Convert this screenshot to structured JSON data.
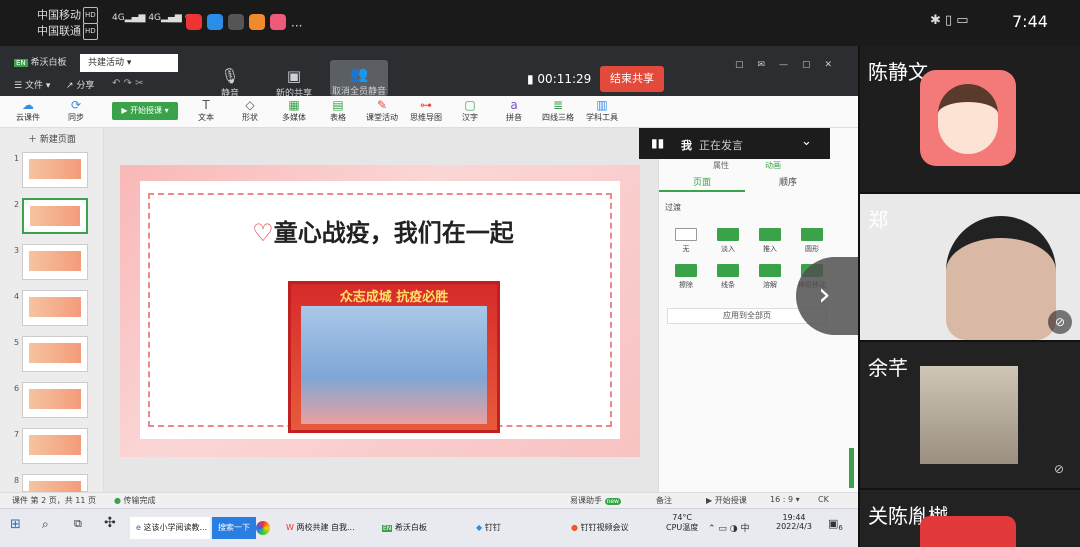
{
  "status_bar": {
    "carrier1": "中国移动",
    "carrier2": "中国联通",
    "hd": "HD",
    "net1": "4G",
    "net2": "4G",
    "time": "7:44"
  },
  "app": {
    "tabs": [
      "希沃白板",
      "共建活动"
    ],
    "menu": [
      "文件",
      "分享"
    ],
    "meeting_tools": [
      "静音",
      "新的共享",
      "取消全员静音"
    ],
    "timer": "00:11:29",
    "end_share": "结束共享",
    "left_tools": [
      "云课件",
      "同步"
    ],
    "start_class": "开始授课",
    "ribbon_tools": [
      "文本",
      "形状",
      "多媒体",
      "表格",
      "课堂活动",
      "思维导图",
      "汉字",
      "拼音",
      "四线三格",
      "学科工具"
    ],
    "new_page": "新建页面",
    "slide_numbers": [
      "1",
      "2",
      "3",
      "4",
      "5",
      "6",
      "7",
      "8"
    ],
    "slide_title": "童心战疫，我们在一起",
    "poster_text": "众志成城  抗疫必胜",
    "right_tabs": [
      "属性",
      "动画"
    ],
    "right_subtabs": [
      "页面",
      "顺序"
    ],
    "transition_label": "过渡",
    "transitions": [
      "无",
      "淡入",
      "推入",
      "圆形",
      "擦除",
      "线条",
      "溶解",
      "神奇移动"
    ],
    "apply_all": "应用到全部页",
    "speaking_name": "我",
    "speaking_text": "正在发言",
    "status_pages": "课件 第 2 页，共 11 页",
    "status_upload": "传输完成",
    "status_right": [
      "易课助手",
      "new",
      "备注",
      "开始授课",
      "16 : 9",
      "CK"
    ]
  },
  "taskbar": {
    "search": "搜索一下",
    "browser": "这该小学阅读教...",
    "items": [
      "两校共建 自我...",
      "希沃白板",
      "钉钉",
      "钉钉视频会议"
    ],
    "temp": "74°C",
    "cpu": "CPU温度",
    "clock_time": "19:44",
    "clock_date": "2022/4/3",
    "badge": "6"
  },
  "participants": [
    {
      "name": "陈静文"
    },
    {
      "name": "郑"
    },
    {
      "name": "余芊"
    },
    {
      "name": "关陈胤樾"
    }
  ],
  "colors": {
    "accent": "#3aa34a",
    "end_share": "#e24b3b",
    "title_bar": "#2b2d31"
  }
}
